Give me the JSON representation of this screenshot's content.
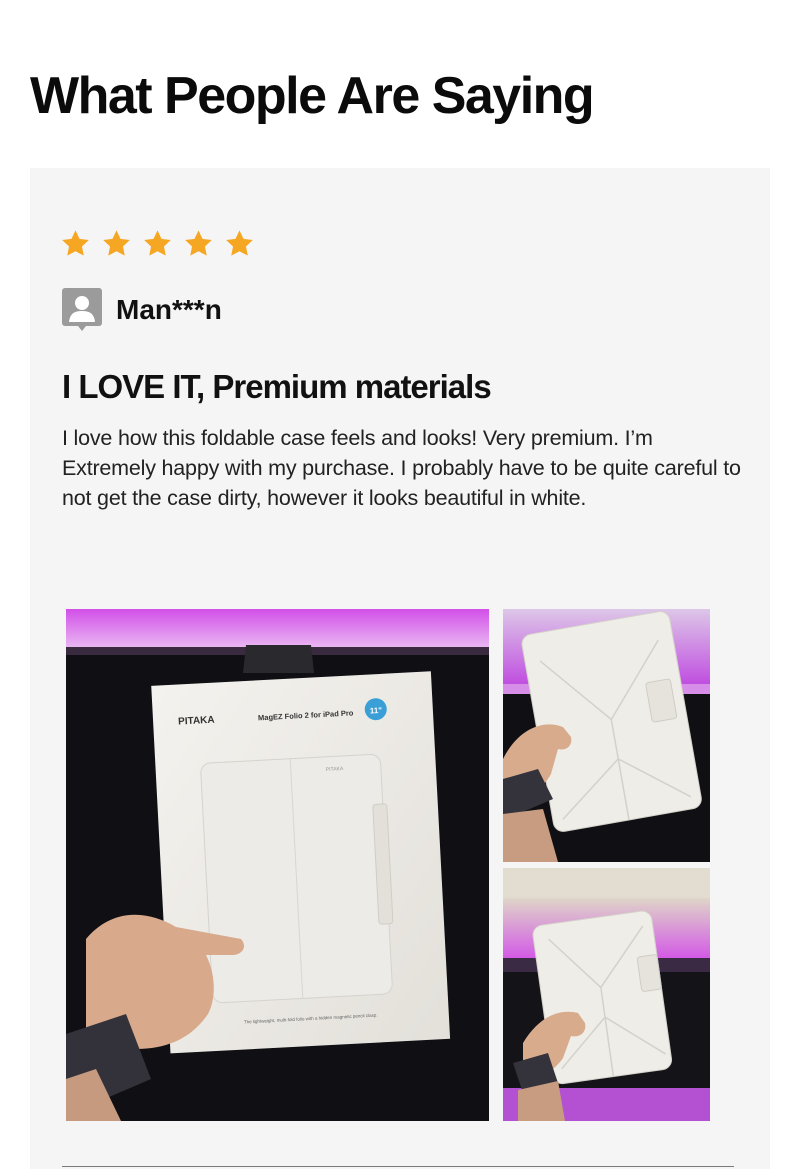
{
  "section": {
    "title": "What People Are Saying"
  },
  "review": {
    "rating": 5,
    "rating_max": 5,
    "star_color": "#F5A623",
    "avatar_icon": "user-avatar-icon",
    "reviewer_name": "Man***n",
    "title": "I LOVE IT, Premium materials",
    "body": "I love how this foldable case feels and looks! Very premium. I’m Extremely happy with my purchase. I probably have to be quite careful to not get the case dirty, however it looks beautiful in white.",
    "photos": [
      {
        "name": "review-photo-boxed-case",
        "box_brand": "PITAKA",
        "box_product": "MagEZ Folio 2 for iPad Pro",
        "box_badge": "11\"",
        "box_tagline": "The lightweight, multi-fold folio with a hidden magnetic pencil clasp.",
        "case_brand": "PITAKA"
      },
      {
        "name": "review-photo-case-in-hand"
      },
      {
        "name": "review-photo-case-folded"
      }
    ]
  }
}
